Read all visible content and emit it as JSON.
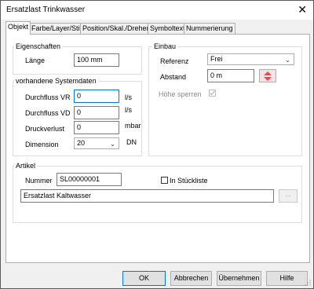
{
  "window": {
    "title": "Ersatzlast Trinkwasser",
    "close_glyph": "✕"
  },
  "tabs": [
    {
      "label": "Objekt",
      "active": true
    },
    {
      "label": "Farbe/Layer/Stift",
      "active": false
    },
    {
      "label": "Position/Skal./Drehen",
      "active": false
    },
    {
      "label": "Symboltext",
      "active": false
    },
    {
      "label": "Nummerierung",
      "active": false
    }
  ],
  "eigenschaften": {
    "title": "Eigenschaften",
    "laenge_label": "Länge",
    "laenge_value": "100 mm"
  },
  "systemdaten": {
    "title": "vorhandene Systemdaten",
    "durchfluss_vr_label": "Durchfluss VR",
    "durchfluss_vr_value": "0",
    "durchfluss_vr_unit": "l/s",
    "durchfluss_vd_label": "Durchfluss VD",
    "durchfluss_vd_value": "0",
    "durchfluss_vd_unit": "l/s",
    "druckverlust_label": "Druckverlust",
    "druckverlust_value": "0",
    "druckverlust_unit": "mbar",
    "dimension_label": "Dimension",
    "dimension_value": "20",
    "dimension_unit": "DN"
  },
  "einbau": {
    "title": "Einbau",
    "referenz_label": "Referenz",
    "referenz_value": "Frei",
    "abstand_label": "Abstand",
    "abstand_value": "0 m",
    "hoehe_sperren_label": "Höhe sperren",
    "hoehe_sperren_checked": true
  },
  "artikel": {
    "title": "Artikel",
    "nummer_label": "Nummer",
    "nummer_value": "SL00000001",
    "in_stueckliste_label": "In Stückliste",
    "in_stueckliste_checked": false,
    "bezeichnung_value": "Ersatzlast Kaltwasser",
    "browse_label": "..."
  },
  "buttons": {
    "ok": "OK",
    "abbrechen": "Abbrechen",
    "uebernehmen": "Übernehmen",
    "hilfe": "Hilfe"
  },
  "colors": {
    "accent": "#0078d7",
    "spin_arrow": "#e05050"
  },
  "icons": {
    "close": "close-icon",
    "dropdown": "chevron-down-icon",
    "spin": "spin-up-down-icon",
    "check": "checkmark-icon",
    "resize": "resize-grip-icon"
  }
}
